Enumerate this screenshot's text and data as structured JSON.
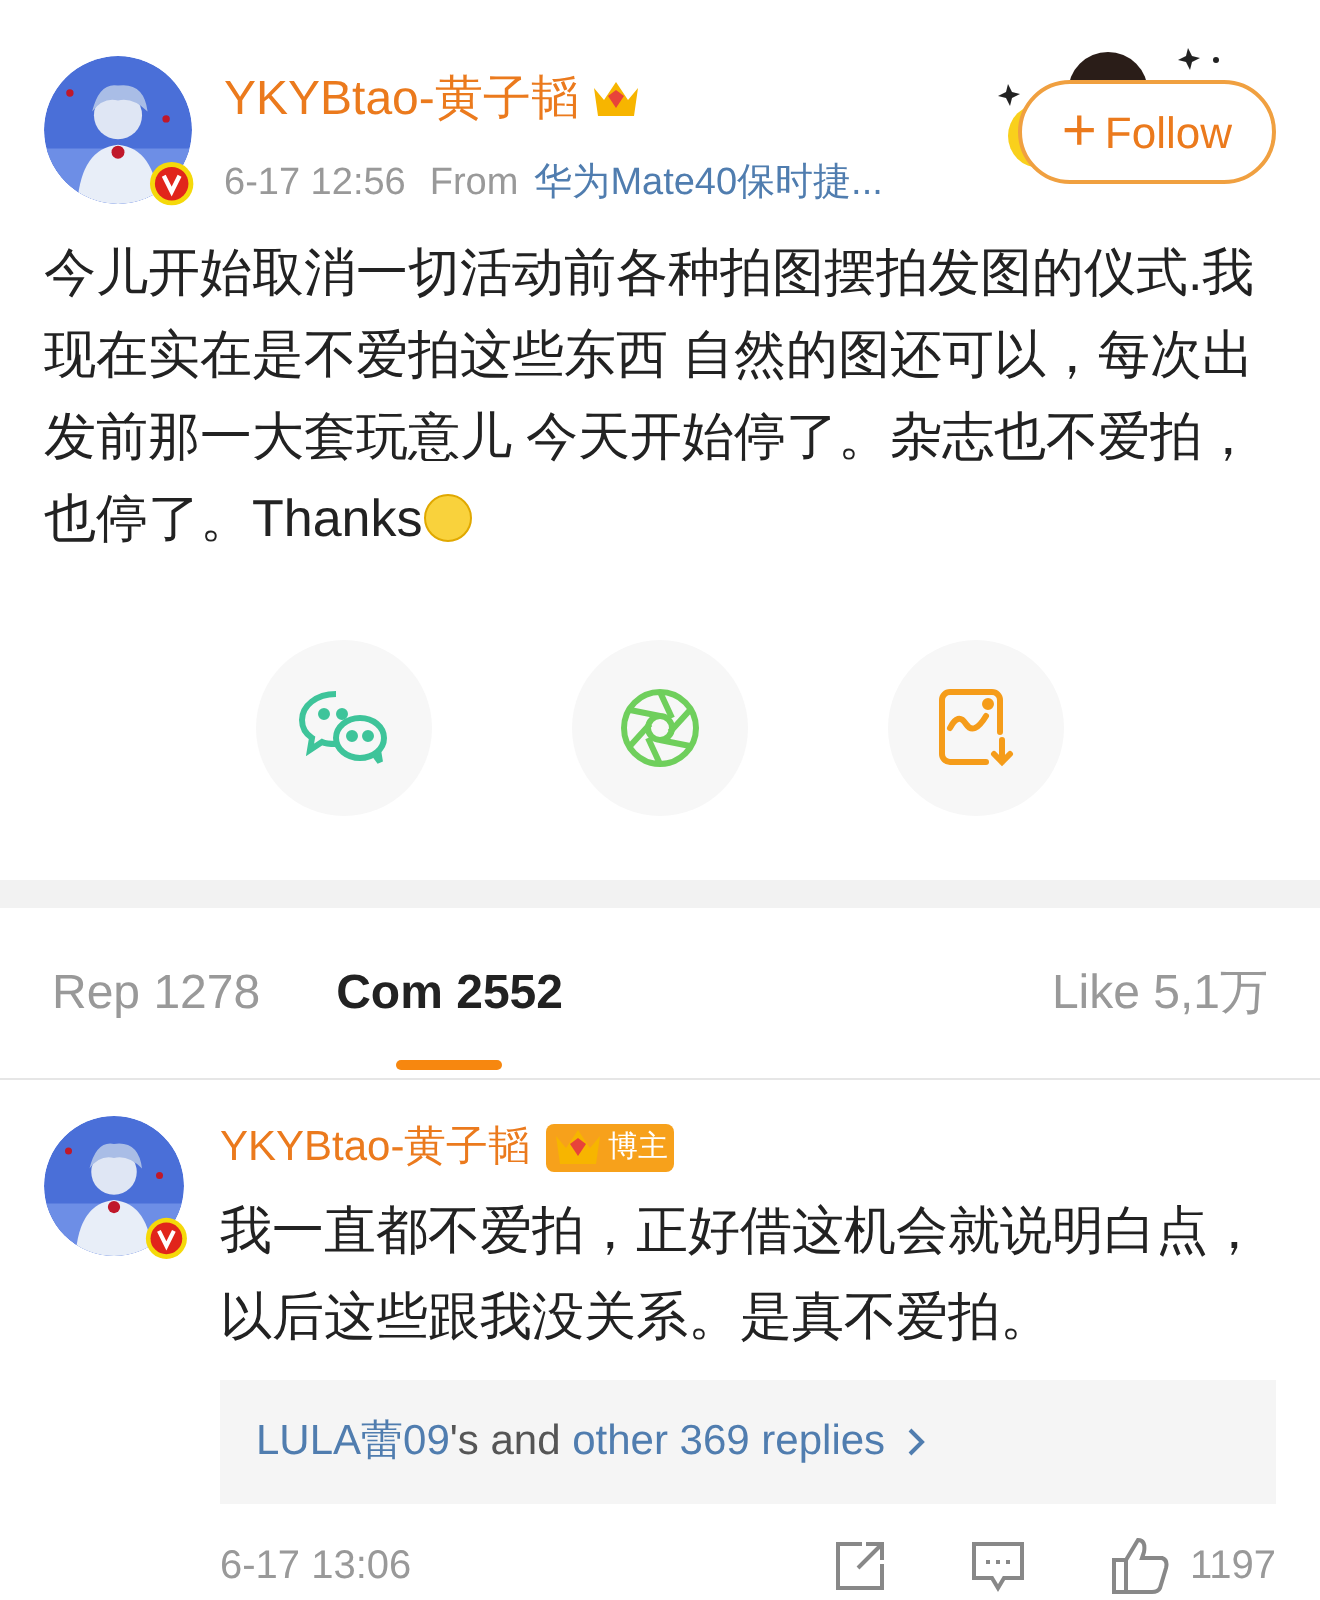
{
  "post": {
    "author": "YKYBtao-黄子韬",
    "time": "6-17 12:56",
    "source_label": "From",
    "source": "华为Mate40保时捷...",
    "follow": "Follow",
    "follow_icon": "+",
    "text": "今儿开始取消一切活动前各种拍图摆拍发图的仪式.我现在实在是不爱拍这些东西 自然的图还可以，每次出发前那一大套玩意儿 今天开始停了。杂志也不爱拍，也停了。Thanks"
  },
  "share_buttons": [
    {
      "kind": "wechat"
    },
    {
      "kind": "moments"
    },
    {
      "kind": "save-image"
    }
  ],
  "tabs": [
    {
      "label": "Rep 1278",
      "selected": false
    },
    {
      "label": "Com 2552",
      "selected": true
    },
    {
      "label": "Like 5,1万",
      "selected": false
    }
  ],
  "comment": {
    "author": "YKYBtao-黄子韬",
    "badge": "博主",
    "text": "我一直都不爱拍，正好借这机会就说明白点，以后这些跟我没关系。是真不爱拍。",
    "replies": [
      {
        "kind": "link",
        "text": "LULA蕾09"
      },
      {
        "kind": "plain",
        "text": "'s and "
      },
      {
        "kind": "link",
        "text": "other 369 replies"
      }
    ],
    "time": "6-17 13:06",
    "likes": "1197"
  }
}
